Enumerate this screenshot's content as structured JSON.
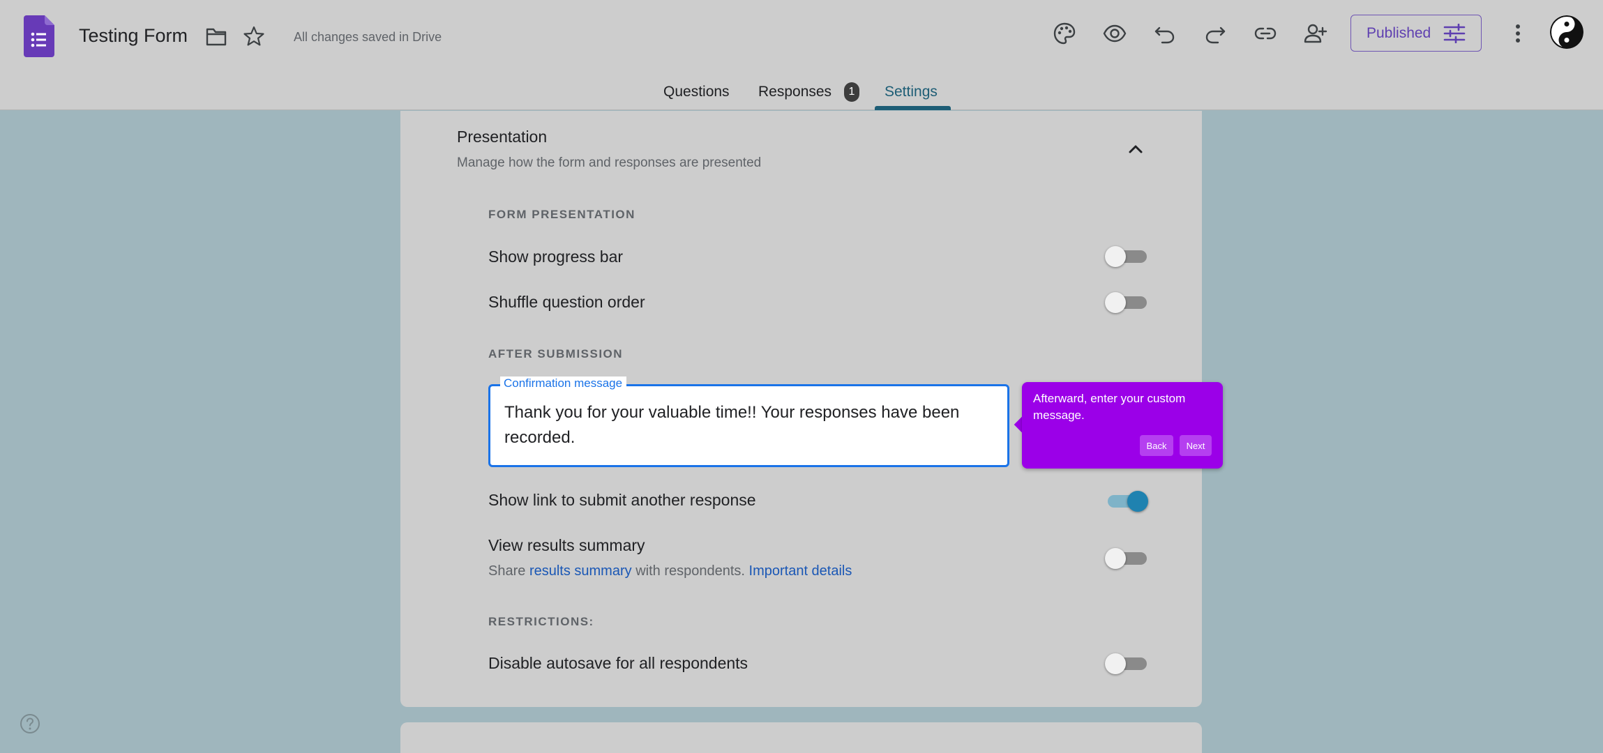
{
  "header": {
    "title": "Testing Form",
    "save_status": "All changes saved in Drive",
    "published_label": "Published",
    "accent_color": "#673ab7"
  },
  "tabs": {
    "questions": "Questions",
    "responses": "Responses",
    "responses_count": "1",
    "settings": "Settings"
  },
  "presentation": {
    "title": "Presentation",
    "subtitle": "Manage how the form and responses are presented",
    "form_presentation_label": "FORM PRESENTATION",
    "show_progress_bar": {
      "label": "Show progress bar",
      "on": false
    },
    "shuffle_question_order": {
      "label": "Shuffle question order",
      "on": false
    },
    "after_submission_label": "AFTER SUBMISSION",
    "confirmation": {
      "label": "Confirmation message",
      "value": "Thank you for your valuable time!! Your responses have been recorded."
    },
    "show_link": {
      "label": "Show link to submit another response",
      "on": true
    },
    "view_results": {
      "label": "View results summary",
      "sub_prefix": "Share ",
      "sub_link1": "results summary",
      "sub_mid": " with respondents. ",
      "sub_link2": "Important details",
      "on": false
    },
    "restrictions_label": "RESTRICTIONS:",
    "disable_autosave": {
      "label": "Disable autosave for all respondents",
      "on": false
    }
  },
  "tooltip": {
    "text": "Afterward, enter your custom message.",
    "back": "Back",
    "next": "Next",
    "color": "#9b00e8"
  }
}
